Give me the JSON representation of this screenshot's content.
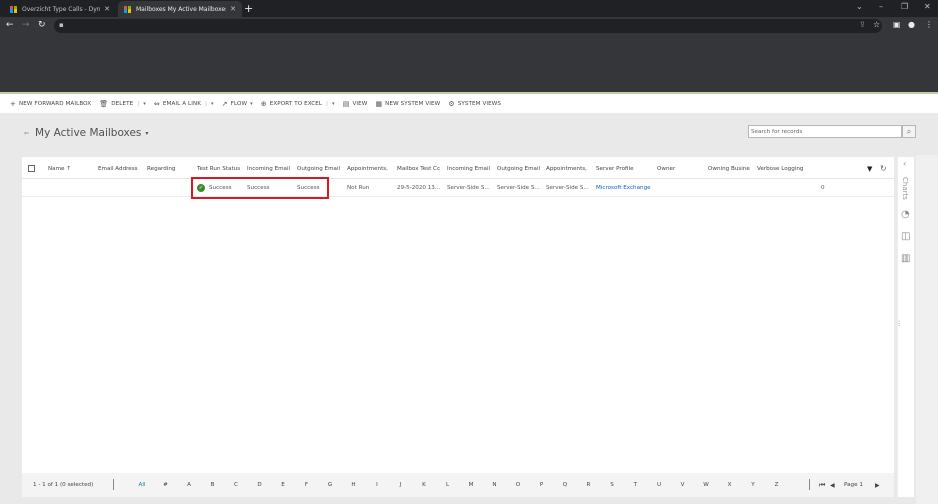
{
  "browser": {
    "tabs": [
      {
        "title": "Overzicht Type Calls - Dynamics",
        "active": false,
        "icon": "microsoft-logo"
      },
      {
        "title": "Mailboxes My Active Mailboxes -",
        "active": true,
        "icon": "microsoft-logo"
      }
    ],
    "new_tab": "+",
    "window_controls": {
      "tab_search": "⌄",
      "minimize": "–",
      "restore": "❐",
      "close": "✕"
    },
    "nav": {
      "back": "←",
      "forward": "→",
      "reload": "↻"
    },
    "address_lock": "🔒",
    "toolbar_icons": {
      "share": "⇪",
      "bookmark": "☆",
      "sidepanel": "▣",
      "profile": "●",
      "menu": "⋮"
    }
  },
  "command_bar": {
    "items": [
      {
        "label": "NEW FORWARD MAILBOX",
        "icon": "+"
      },
      {
        "label": "DELETE",
        "icon": "🗑",
        "split": true
      },
      {
        "label": "EMAIL A LINK",
        "icon": "⇔",
        "split": true
      },
      {
        "label": "FLOW",
        "icon": "↗",
        "dropdown": true
      },
      {
        "label": "EXPORT TO EXCEL",
        "icon": "⊕",
        "split": true
      },
      {
        "label": "VIEW",
        "icon": "▤"
      },
      {
        "label": "NEW SYSTEM VIEW",
        "icon": "▦"
      },
      {
        "label": "SYSTEM VIEWS",
        "icon": "⚙"
      }
    ],
    "dropdown_glyph": "▾",
    "sep_glyph": "|"
  },
  "view": {
    "pin_icon": "⇐",
    "title": "My Active Mailboxes",
    "caret": "▾",
    "search_placeholder": "Search for records",
    "search_icon": "⌕"
  },
  "grid": {
    "columns": [
      "Name ↑",
      "Email Address",
      "Regarding",
      "Test Run Status",
      "Incoming Email",
      "Outgoing Email",
      "Appointments,",
      "Mailbox Test Cc",
      "Incoming Email",
      "Outgoing Email",
      "Appointments,",
      "Server Profile",
      "Owner",
      "Owning Busine",
      "Verbose Logging"
    ],
    "rows": [
      {
        "name": "",
        "email": "",
        "regarding": "",
        "test_run_status": "Success",
        "incoming_email": "Success",
        "outgoing_email": "Success",
        "appointments": "Not Run",
        "mailbox_test_completed": "29-5-2020 13...",
        "incoming_email_sync": "Server-Side S...",
        "outgoing_email_sync": "Server-Side S...",
        "appointments_sync": "Server-Side S...",
        "server_profile": "Microsoft Exchange",
        "owner": "",
        "owning_business": "",
        "verbose_logging": "0"
      }
    ],
    "filter_icon": "▼",
    "refresh_icon": "↻",
    "status_ok_glyph": "✓"
  },
  "footer": {
    "count": "1 - 1 of 1 (0 selected)",
    "letters": [
      "All",
      "#",
      "A",
      "B",
      "C",
      "D",
      "E",
      "F",
      "G",
      "H",
      "I",
      "J",
      "K",
      "L",
      "M",
      "N",
      "O",
      "P",
      "Q",
      "R",
      "S",
      "T",
      "U",
      "V",
      "W",
      "X",
      "Y",
      "Z"
    ],
    "first_page": "⏮",
    "prev_page": "◀",
    "page_label": "Page 1",
    "next_page": "▶"
  },
  "charts_pane": {
    "collapse": "‹",
    "label": "Charts",
    "icons": [
      "◔",
      "◫",
      "▥"
    ],
    "dots": "⋯"
  },
  "colors": {
    "highlight": "#d11a22",
    "link": "#1160b7",
    "success": "#3c8a2e",
    "alpha_active": "#1b80b9"
  }
}
